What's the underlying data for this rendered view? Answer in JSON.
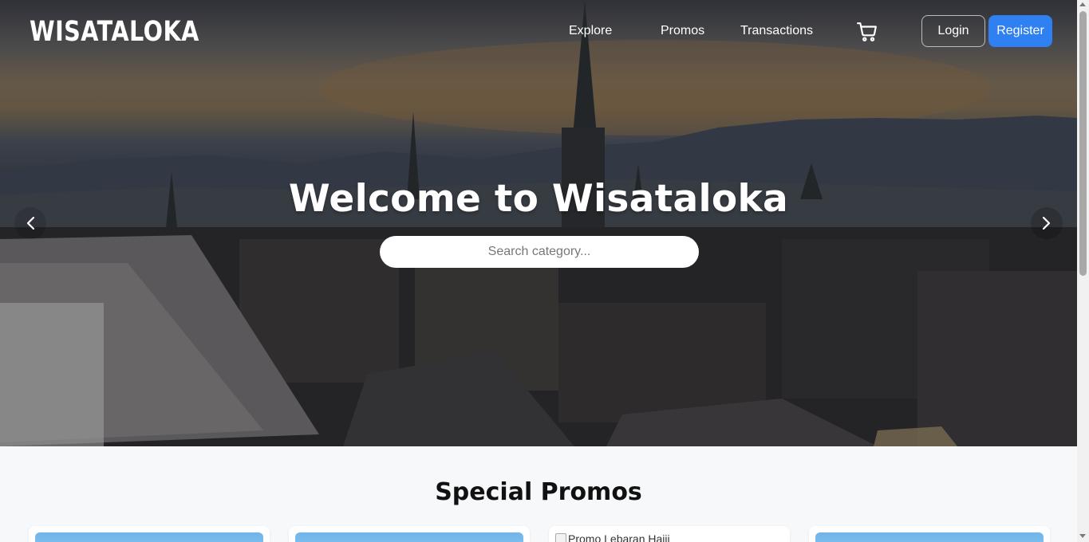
{
  "navbar": {
    "logo": "WISATALOKA",
    "links": [
      "Explore",
      "Promos",
      "Transactions"
    ],
    "cart_icon": "shopping-cart-icon",
    "login_label": "Login",
    "register_label": "Register"
  },
  "hero": {
    "title": "Welcome to Wisataloka",
    "search_placeholder": "Search category...",
    "prev_icon": "chevron-left-icon",
    "next_icon": "chevron-right-icon"
  },
  "promos": {
    "section_title": "Special Promos",
    "cards": [
      {
        "alt": ""
      },
      {
        "alt": ""
      },
      {
        "alt": "Promo Lebaran Hajii"
      },
      {
        "alt": ""
      }
    ]
  },
  "colors": {
    "accent": "#2f80f0",
    "page_background": "#f6f8fa"
  }
}
